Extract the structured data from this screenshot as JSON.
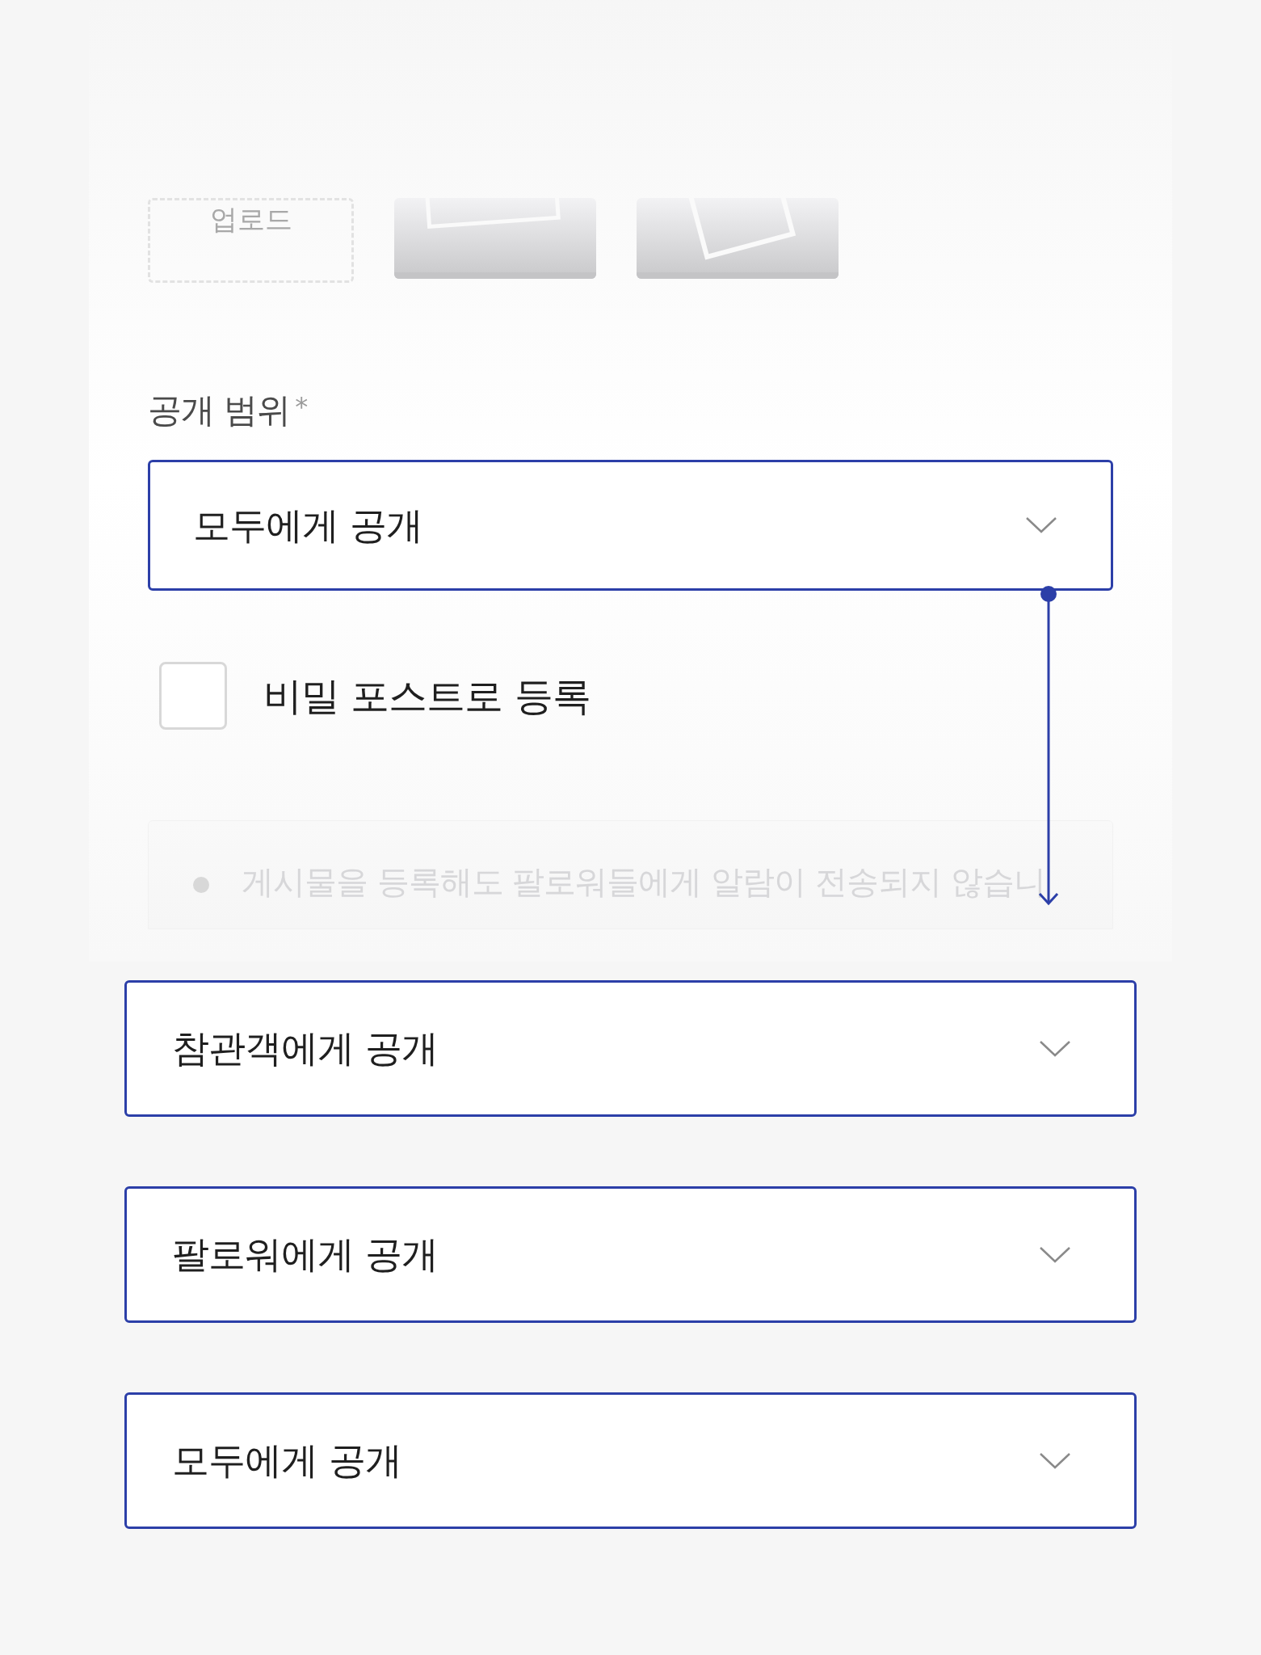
{
  "upload": {
    "label": "업로드"
  },
  "visibility": {
    "label": "공개 범위",
    "required_mark": "*",
    "value": "모두에게 공개"
  },
  "secret_post": {
    "label": "비밀 포스트로 등록",
    "checked": false
  },
  "notice": "게시물을 등록해도 팔로워들에게 알람이 전송되지 않습니",
  "variants": [
    {
      "value": "참관객에게 공개"
    },
    {
      "value": "팔로워에게 공개"
    },
    {
      "value": "모두에게 공개"
    }
  ]
}
